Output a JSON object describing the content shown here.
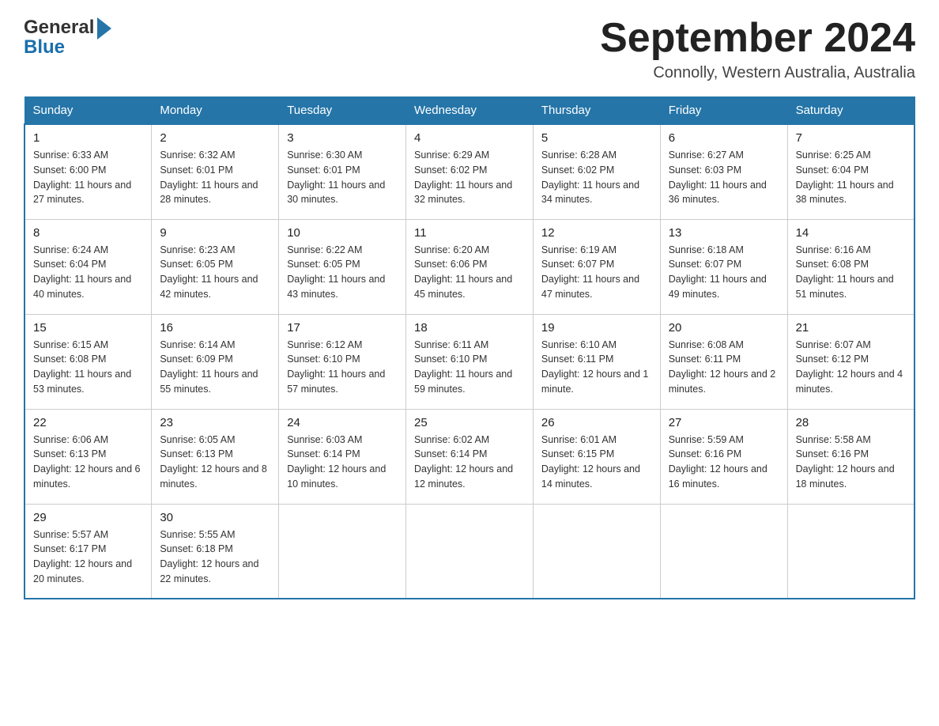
{
  "header": {
    "logo_general": "General",
    "logo_blue": "Blue",
    "month_year": "September 2024",
    "location": "Connolly, Western Australia, Australia"
  },
  "days_of_week": [
    "Sunday",
    "Monday",
    "Tuesday",
    "Wednesday",
    "Thursday",
    "Friday",
    "Saturday"
  ],
  "weeks": [
    [
      {
        "day": "1",
        "sunrise": "6:33 AM",
        "sunset": "6:00 PM",
        "daylight": "11 hours and 27 minutes."
      },
      {
        "day": "2",
        "sunrise": "6:32 AM",
        "sunset": "6:01 PM",
        "daylight": "11 hours and 28 minutes."
      },
      {
        "day": "3",
        "sunrise": "6:30 AM",
        "sunset": "6:01 PM",
        "daylight": "11 hours and 30 minutes."
      },
      {
        "day": "4",
        "sunrise": "6:29 AM",
        "sunset": "6:02 PM",
        "daylight": "11 hours and 32 minutes."
      },
      {
        "day": "5",
        "sunrise": "6:28 AM",
        "sunset": "6:02 PM",
        "daylight": "11 hours and 34 minutes."
      },
      {
        "day": "6",
        "sunrise": "6:27 AM",
        "sunset": "6:03 PM",
        "daylight": "11 hours and 36 minutes."
      },
      {
        "day": "7",
        "sunrise": "6:25 AM",
        "sunset": "6:04 PM",
        "daylight": "11 hours and 38 minutes."
      }
    ],
    [
      {
        "day": "8",
        "sunrise": "6:24 AM",
        "sunset": "6:04 PM",
        "daylight": "11 hours and 40 minutes."
      },
      {
        "day": "9",
        "sunrise": "6:23 AM",
        "sunset": "6:05 PM",
        "daylight": "11 hours and 42 minutes."
      },
      {
        "day": "10",
        "sunrise": "6:22 AM",
        "sunset": "6:05 PM",
        "daylight": "11 hours and 43 minutes."
      },
      {
        "day": "11",
        "sunrise": "6:20 AM",
        "sunset": "6:06 PM",
        "daylight": "11 hours and 45 minutes."
      },
      {
        "day": "12",
        "sunrise": "6:19 AM",
        "sunset": "6:07 PM",
        "daylight": "11 hours and 47 minutes."
      },
      {
        "day": "13",
        "sunrise": "6:18 AM",
        "sunset": "6:07 PM",
        "daylight": "11 hours and 49 minutes."
      },
      {
        "day": "14",
        "sunrise": "6:16 AM",
        "sunset": "6:08 PM",
        "daylight": "11 hours and 51 minutes."
      }
    ],
    [
      {
        "day": "15",
        "sunrise": "6:15 AM",
        "sunset": "6:08 PM",
        "daylight": "11 hours and 53 minutes."
      },
      {
        "day": "16",
        "sunrise": "6:14 AM",
        "sunset": "6:09 PM",
        "daylight": "11 hours and 55 minutes."
      },
      {
        "day": "17",
        "sunrise": "6:12 AM",
        "sunset": "6:10 PM",
        "daylight": "11 hours and 57 minutes."
      },
      {
        "day": "18",
        "sunrise": "6:11 AM",
        "sunset": "6:10 PM",
        "daylight": "11 hours and 59 minutes."
      },
      {
        "day": "19",
        "sunrise": "6:10 AM",
        "sunset": "6:11 PM",
        "daylight": "12 hours and 1 minute."
      },
      {
        "day": "20",
        "sunrise": "6:08 AM",
        "sunset": "6:11 PM",
        "daylight": "12 hours and 2 minutes."
      },
      {
        "day": "21",
        "sunrise": "6:07 AM",
        "sunset": "6:12 PM",
        "daylight": "12 hours and 4 minutes."
      }
    ],
    [
      {
        "day": "22",
        "sunrise": "6:06 AM",
        "sunset": "6:13 PM",
        "daylight": "12 hours and 6 minutes."
      },
      {
        "day": "23",
        "sunrise": "6:05 AM",
        "sunset": "6:13 PM",
        "daylight": "12 hours and 8 minutes."
      },
      {
        "day": "24",
        "sunrise": "6:03 AM",
        "sunset": "6:14 PM",
        "daylight": "12 hours and 10 minutes."
      },
      {
        "day": "25",
        "sunrise": "6:02 AM",
        "sunset": "6:14 PM",
        "daylight": "12 hours and 12 minutes."
      },
      {
        "day": "26",
        "sunrise": "6:01 AM",
        "sunset": "6:15 PM",
        "daylight": "12 hours and 14 minutes."
      },
      {
        "day": "27",
        "sunrise": "5:59 AM",
        "sunset": "6:16 PM",
        "daylight": "12 hours and 16 minutes."
      },
      {
        "day": "28",
        "sunrise": "5:58 AM",
        "sunset": "6:16 PM",
        "daylight": "12 hours and 18 minutes."
      }
    ],
    [
      {
        "day": "29",
        "sunrise": "5:57 AM",
        "sunset": "6:17 PM",
        "daylight": "12 hours and 20 minutes."
      },
      {
        "day": "30",
        "sunrise": "5:55 AM",
        "sunset": "6:18 PM",
        "daylight": "12 hours and 22 minutes."
      },
      null,
      null,
      null,
      null,
      null
    ]
  ],
  "labels": {
    "sunrise": "Sunrise:",
    "sunset": "Sunset:",
    "daylight": "Daylight:"
  }
}
